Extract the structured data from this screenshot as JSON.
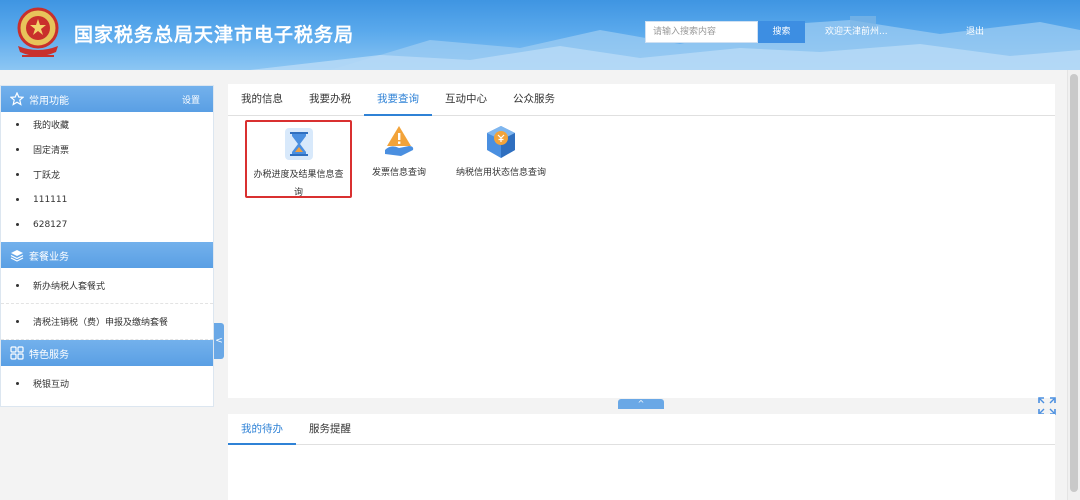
{
  "header": {
    "title": "国家税务总局天津市电子税务局",
    "search_placeholder": "请输入搜索内容",
    "search_button": "搜索",
    "welcome": "欢迎天津前州...",
    "logout": "退出"
  },
  "sidebar": {
    "sections": [
      {
        "title": "常用功能",
        "icon": "star-icon",
        "action": "设置",
        "items": [
          "我的收藏",
          "固定清票",
          "丁跃龙",
          "111111",
          "628127"
        ]
      },
      {
        "title": "套餐业务",
        "icon": "layers-icon",
        "items": [
          "新办纳税人套餐式",
          "清税注销税（费）申报及缴纳套餐"
        ]
      },
      {
        "title": "特色服务",
        "icon": "grid-icon",
        "items": [
          "税银互动"
        ]
      }
    ],
    "collapse_glyph": "<"
  },
  "main": {
    "tabs": [
      "我的信息",
      "我要办税",
      "我要查询",
      "互动中心",
      "公众服务"
    ],
    "active_tab": "我要查询",
    "tiles": [
      {
        "label_line1": "办税进度及结果信息查",
        "label_line2": "询",
        "icon": "hourglass-icon",
        "highlighted": true
      },
      {
        "label": "发票信息查询",
        "icon": "warning-invoice-icon"
      },
      {
        "label": "纳税信用状态信息查询",
        "icon": "credit-cube-icon"
      }
    ],
    "expand_glyph": "^"
  },
  "bottom": {
    "tabs": [
      "我的待办",
      "服务提醒"
    ],
    "active_tab": "我的待办"
  },
  "colors": {
    "header_blue": "#3f95e2",
    "accent": "#2f82d6",
    "highlight_red": "#d93030",
    "section_blue": "#5a9fe4"
  }
}
